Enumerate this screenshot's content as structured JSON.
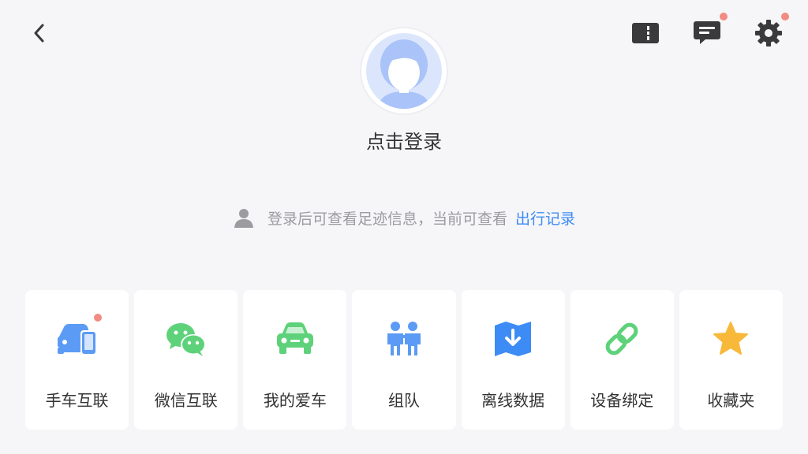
{
  "colors": {
    "background": "#f6f6f8",
    "icon_dark": "#3a3a3d",
    "badge_red": "#f28b82",
    "link_blue": "#3d8bf5",
    "hint_gray": "#9b9ba0",
    "avatar_blue": "#aac3f8"
  },
  "header": {
    "back_icon": "chevron-left-icon",
    "right_icons": [
      {
        "name": "book-icon",
        "badge": false
      },
      {
        "name": "message-icon",
        "badge": true
      },
      {
        "name": "gear-icon",
        "badge": true
      }
    ]
  },
  "profile": {
    "login_text": "点击登录"
  },
  "hint": {
    "text": "登录后可查看足迹信息，当前可查看",
    "link": "出行记录"
  },
  "features": [
    {
      "label": "手车互联",
      "icon": "car-phone-icon",
      "badge": true,
      "color": "#5b9bf5"
    },
    {
      "label": "微信互联",
      "icon": "wechat-icon",
      "badge": false,
      "color": "#5ed27a"
    },
    {
      "label": "我的爱车",
      "icon": "car-icon",
      "badge": false,
      "color": "#5ed27a"
    },
    {
      "label": "组队",
      "icon": "team-icon",
      "badge": false,
      "color": "#5b9bf5"
    },
    {
      "label": "离线数据",
      "icon": "offline-map-icon",
      "badge": false,
      "color": "#3d8bf5"
    },
    {
      "label": "设备绑定",
      "icon": "link-icon",
      "badge": false,
      "color": "#5ed27a"
    },
    {
      "label": "收藏夹",
      "icon": "star-icon",
      "badge": false,
      "color": "#f8b93b"
    }
  ]
}
